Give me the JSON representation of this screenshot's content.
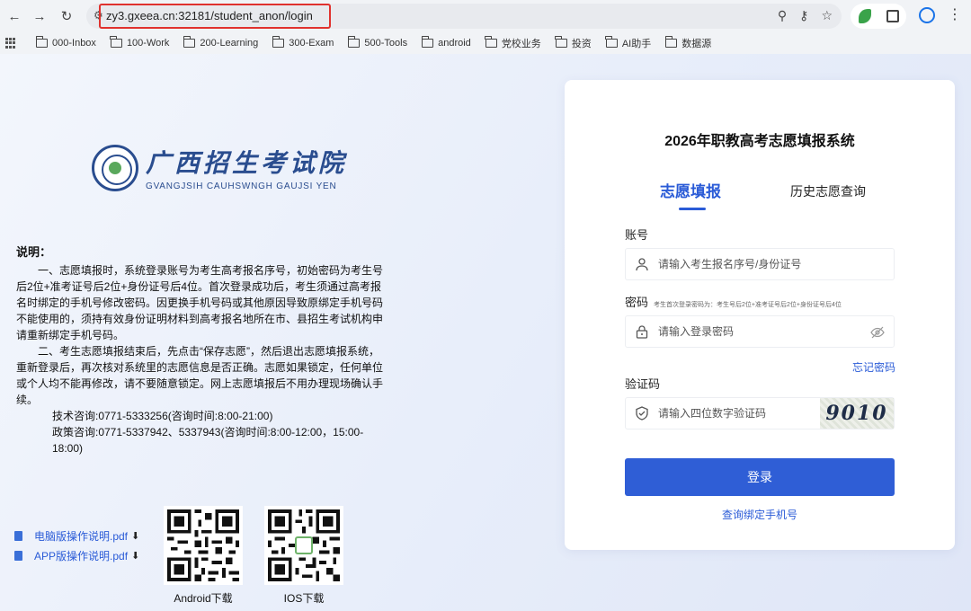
{
  "browser": {
    "url": "zy3.gxeea.cn:32181/student_anon/login",
    "bookmarks": [
      "000-Inbox",
      "100-Work",
      "200-Learning",
      "300-Exam",
      "500-Tools",
      "android",
      "党校业务",
      "投资",
      "AI助手",
      "数据源"
    ]
  },
  "logo": {
    "name_cn": "广西招生考试院",
    "name_en": "GVANGJSIH CAUHSWNGH GAUJSI YEN"
  },
  "notes": {
    "title": "说明：",
    "para1": "一、志愿填报时，系统登录账号为考生高考报名序号，初始密码为考生号后2位+准考证号后2位+身份证号后4位。首次登录成功后，考生须通过高考报名时绑定的手机号修改密码。因更换手机号码或其他原因导致原绑定手机号码不能使用的，须持有效身份证明材料到高考报名地所在市、县招生考试机构申请重新绑定手机号码。",
    "para2": "二、考生志愿填报结束后，先点击“保存志愿”，然后退出志愿填报系统，重新登录后，再次核对系统里的志愿信息是否正确。志愿如果锁定，任何单位或个人均不能再修改，请不要随意锁定。网上志愿填报后不用办理现场确认手续。",
    "tech": "技术咨询:0771-5333256(咨询时间:8:00-21:00)",
    "policy": "政策咨询:0771-5337942、5337943(咨询时间:8:00-12:00，15:00-18:00)"
  },
  "docs": [
    {
      "label": "电脑版操作说明.pdf"
    },
    {
      "label": "APP版操作说明.pdf"
    }
  ],
  "qr": {
    "android_label": "Android下载",
    "ios_label": "IOS下载"
  },
  "login": {
    "title": "2026年职教高考志愿填报系统",
    "tab_active": "志愿填报",
    "tab_history": "历史志愿查询",
    "account_label": "账号",
    "account_placeholder": "请输入考生报名序号/身份证号",
    "password_label": "密码",
    "password_hint": "考生首次登录密码为：考生号后2位+准考证号后2位+身份证号后4位",
    "password_placeholder": "请输入登录密码",
    "forgot": "忘记密码",
    "captcha_label": "验证码",
    "captcha_placeholder": "请输入四位数字验证码",
    "captcha_code": "9010",
    "submit": "登录",
    "bind_phone": "查询绑定手机号"
  },
  "colors": {
    "accent": "#2f5ed6",
    "highlight": "#e0322e"
  }
}
